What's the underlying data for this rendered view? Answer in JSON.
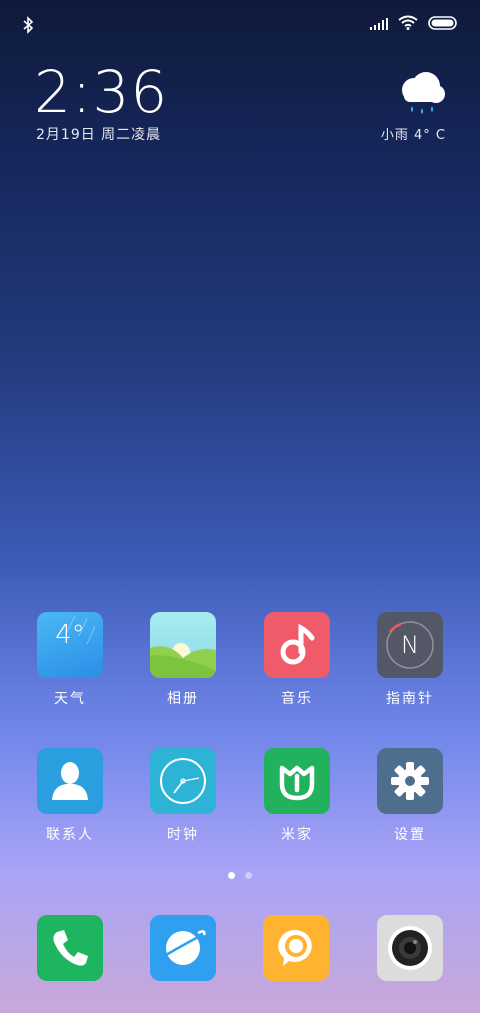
{
  "status": {
    "bluetooth": "bluetooth-icon",
    "signal": "signal-icon",
    "wifi": "wifi-icon",
    "battery": "battery-icon"
  },
  "lock": {
    "time": "2:36",
    "date": "2月19日 周二凌晨"
  },
  "weather": {
    "icon": "rain-cloud-icon",
    "text": "小雨 4° C"
  },
  "apps_row1": [
    {
      "label": "天气",
      "tile_text": "4°",
      "color": "#3aa8f0"
    },
    {
      "label": "相册",
      "color": "#9be0e8"
    },
    {
      "label": "音乐",
      "color": "#f05b6a"
    },
    {
      "label": "指南针",
      "tile_text": "N",
      "color": "#565a66"
    }
  ],
  "apps_row2": [
    {
      "label": "联系人",
      "color": "#2b9ee0"
    },
    {
      "label": "时钟",
      "color": "#2db3d6"
    },
    {
      "label": "米家",
      "color": "#22b15c"
    },
    {
      "label": "设置",
      "color": "#4d6e8c"
    }
  ],
  "pager": {
    "count": 2,
    "active": 0
  },
  "dock": [
    {
      "name": "phone",
      "color": "#1eb560"
    },
    {
      "name": "browser",
      "color": "#2f9ff0"
    },
    {
      "name": "messages",
      "color": "#ffb330"
    },
    {
      "name": "camera",
      "color": "#d8d8d8"
    }
  ]
}
